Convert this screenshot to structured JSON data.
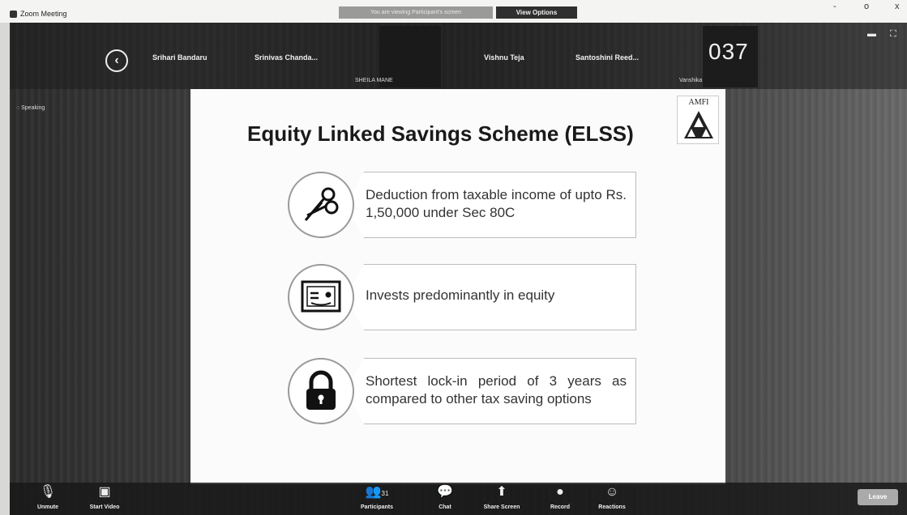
{
  "window": {
    "app_title": "Zoom Meeting",
    "share_info": "You are viewing Participant's screen",
    "view_options": "View Options",
    "controls": [
      "-",
      "o",
      "x"
    ]
  },
  "gallery": {
    "participants": [
      {
        "name": "Srihari Bandaru"
      },
      {
        "name": "Srinivas Chanda..."
      },
      {
        "name": "Vishnu Teja"
      },
      {
        "name": "Santoshini Reed..."
      }
    ],
    "mic_labels": [
      "SHEILA MANE",
      "Vanshika M..."
    ],
    "timer": "037",
    "speaking_label": "Speaking"
  },
  "slide": {
    "title": "Equity Linked Savings Scheme (ELSS)",
    "logo_text": "AMFI",
    "features": [
      {
        "icon": "scissors-icon",
        "text": "Deduction from taxable income of upto Rs. 1,50,000 under Sec 80C"
      },
      {
        "icon": "equity-certificate-icon",
        "text": "Invests predominantly in equity"
      },
      {
        "icon": "lock-icon",
        "text": "Shortest lock-in period of 3 years as compared to other tax saving options"
      }
    ]
  },
  "toolbar": {
    "unmute": "Unmute",
    "start_video": "Start Video",
    "participants": "Participants",
    "participants_count": "31",
    "chat": "Chat",
    "share_screen": "Share Screen",
    "record": "Record",
    "reactions": "Reactions",
    "leave": "Leave"
  }
}
